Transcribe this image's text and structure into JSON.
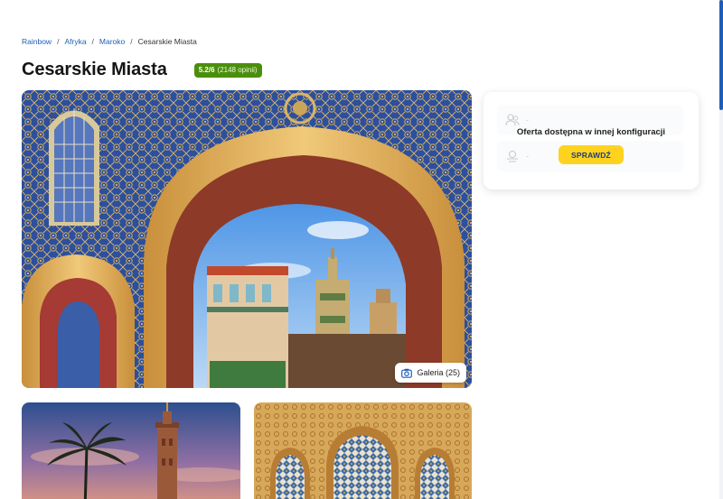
{
  "breadcrumb": {
    "items": [
      "Rainbow",
      "Afryka",
      "Maroko"
    ],
    "current": "Cesarskie Miasta",
    "separator": "/"
  },
  "title": "Cesarskie Miasta",
  "rating": {
    "score": "5.2/6",
    "count": "(2148 opinii)",
    "color": "#4a8f0a"
  },
  "gallery": {
    "label": "Galeria (25)",
    "icon": "camera-icon"
  },
  "offer": {
    "message": "Oferta dostępna w innej konfiguracji",
    "button": "SPRAWDŹ",
    "field_1_value": "-",
    "field_2_value": "-",
    "field_1_icon": "travelers-icon",
    "field_2_icon": "meal-icon"
  },
  "colors": {
    "link": "#1d5fb8",
    "accent": "#ffd21f",
    "accent_text": "#1d3f7a"
  }
}
